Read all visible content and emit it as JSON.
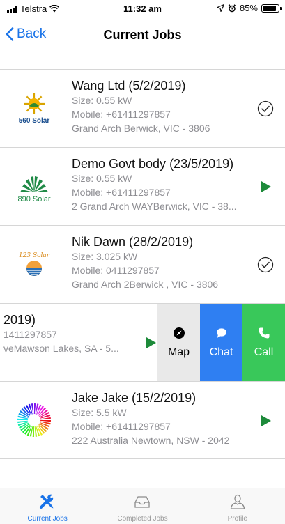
{
  "status_bar": {
    "carrier": "Telstra",
    "time": "11:32 am",
    "battery": "85%",
    "battery_level": 0.85
  },
  "nav": {
    "back_label": "Back",
    "title": "Current Jobs"
  },
  "jobs": [
    {
      "title": "Wang Ltd (5/2/2019)",
      "size": "Size: 0.55 kW",
      "mobile": "Mobile: +61411297857",
      "address": "Grand Arch Berwick, VIC - 3806",
      "logo_text": "560 Solar",
      "status": "check-circle-icon"
    },
    {
      "title": "Demo Govt body (23/5/2019)",
      "size": "Size: 0.55 kW",
      "mobile": "Mobile: +61411297857",
      "address": "2 Grand Arch WAYBerwick, VIC - 38...",
      "logo_text": "890 Solar",
      "status": "play-icon"
    },
    {
      "title": "Nik Dawn (28/2/2019)",
      "size": "Size: 3.025 kW",
      "mobile": "Mobile: 0411297857",
      "address": "Grand Arch 2Berwick , VIC - 3806",
      "logo_text": "123 Solar",
      "status": "check-circle-icon"
    },
    {
      "title": "2019)",
      "size": "",
      "mobile": "1411297857",
      "address": "veMawson Lakes, SA - 5...",
      "logo_text": "",
      "status": "play-icon"
    },
    {
      "title": "Jake Jake (15/2/2019)",
      "size": "Size: 5.5 kW",
      "mobile": "Mobile: +61411297857",
      "address": "222 Australia Newtown, NSW - 2042",
      "logo_text": "",
      "status": "play-icon"
    }
  ],
  "swipe_actions": {
    "map": "Map",
    "chat": "Chat",
    "call": "Call"
  },
  "tabs": [
    {
      "label": "Current Jobs",
      "icon": "tools-icon"
    },
    {
      "label": "Completed Jobs",
      "icon": "inbox-icon"
    },
    {
      "label": "Profile",
      "icon": "profile-icon"
    }
  ],
  "colors": {
    "accent": "#1a73e8",
    "play_green": "#1d8a3a",
    "chat_blue": "#2f7ff2",
    "call_green": "#39c85a",
    "map_gray": "#e9e9e9"
  }
}
